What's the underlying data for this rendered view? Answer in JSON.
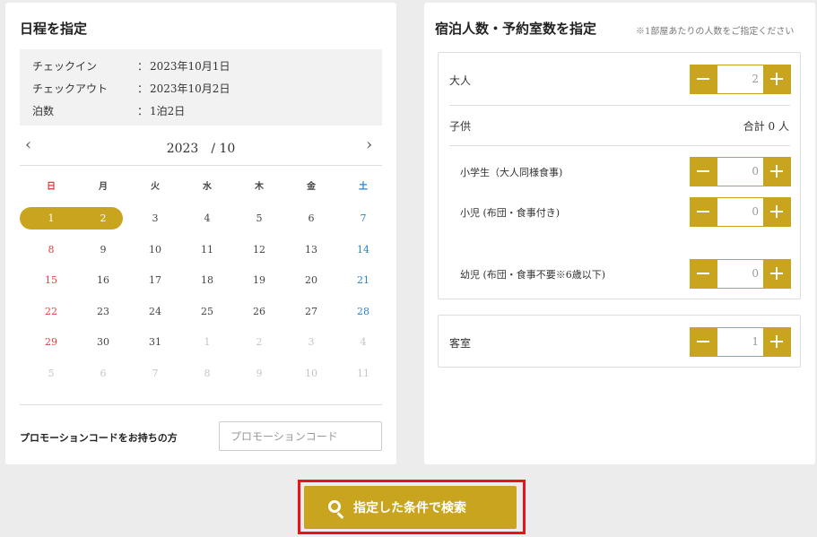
{
  "schedule": {
    "title": "日程を指定",
    "summary": [
      {
        "label": "チェックイン",
        "value": "2023年10月1日"
      },
      {
        "label": "チェックアウト",
        "value": "2023年10月2日"
      },
      {
        "label": "泊数",
        "value": "1泊2日"
      }
    ],
    "colon": "：",
    "calendar": {
      "prev": "‹",
      "next": "›",
      "month_label": "2023　/ 10",
      "weekdays": [
        "日",
        "月",
        "火",
        "水",
        "木",
        "金",
        "土"
      ],
      "weeks": [
        [
          "1",
          "2",
          "3",
          "4",
          "5",
          "6",
          "7"
        ],
        [
          "8",
          "9",
          "10",
          "11",
          "12",
          "13",
          "14"
        ],
        [
          "15",
          "16",
          "17",
          "18",
          "19",
          "20",
          "21"
        ],
        [
          "22",
          "23",
          "24",
          "25",
          "26",
          "27",
          "28"
        ],
        [
          "29",
          "30",
          "31",
          "1",
          "2",
          "3",
          "4"
        ],
        [
          "5",
          "6",
          "7",
          "8",
          "9",
          "10",
          "11"
        ]
      ],
      "selected_range": [
        "1",
        "2"
      ],
      "accent": "#c9a51f"
    },
    "promo": {
      "label": "プロモーションコードをお持ちの方",
      "placeholder": "プロモーションコード"
    }
  },
  "guests": {
    "title": "宿泊人数・予約室数を指定",
    "note": "※1部屋あたりの人数をご指定ください",
    "adult": {
      "label": "大人",
      "value": "2"
    },
    "children": {
      "label": "子供",
      "total": "合計 0 人"
    },
    "elementary": {
      "label": "小学生（大人同様食事)",
      "value": "0"
    },
    "infant": {
      "label": "小児 (布団・食事付き)",
      "value": "0"
    },
    "baby": {
      "label": "幼児 (布団・食事不要※6歳以下)",
      "value": "0"
    },
    "room": {
      "label": "客室",
      "value": "1"
    }
  },
  "search": {
    "label": "指定した条件で検索",
    "icon": "search-icon",
    "highlight_color": "#e8141b"
  }
}
